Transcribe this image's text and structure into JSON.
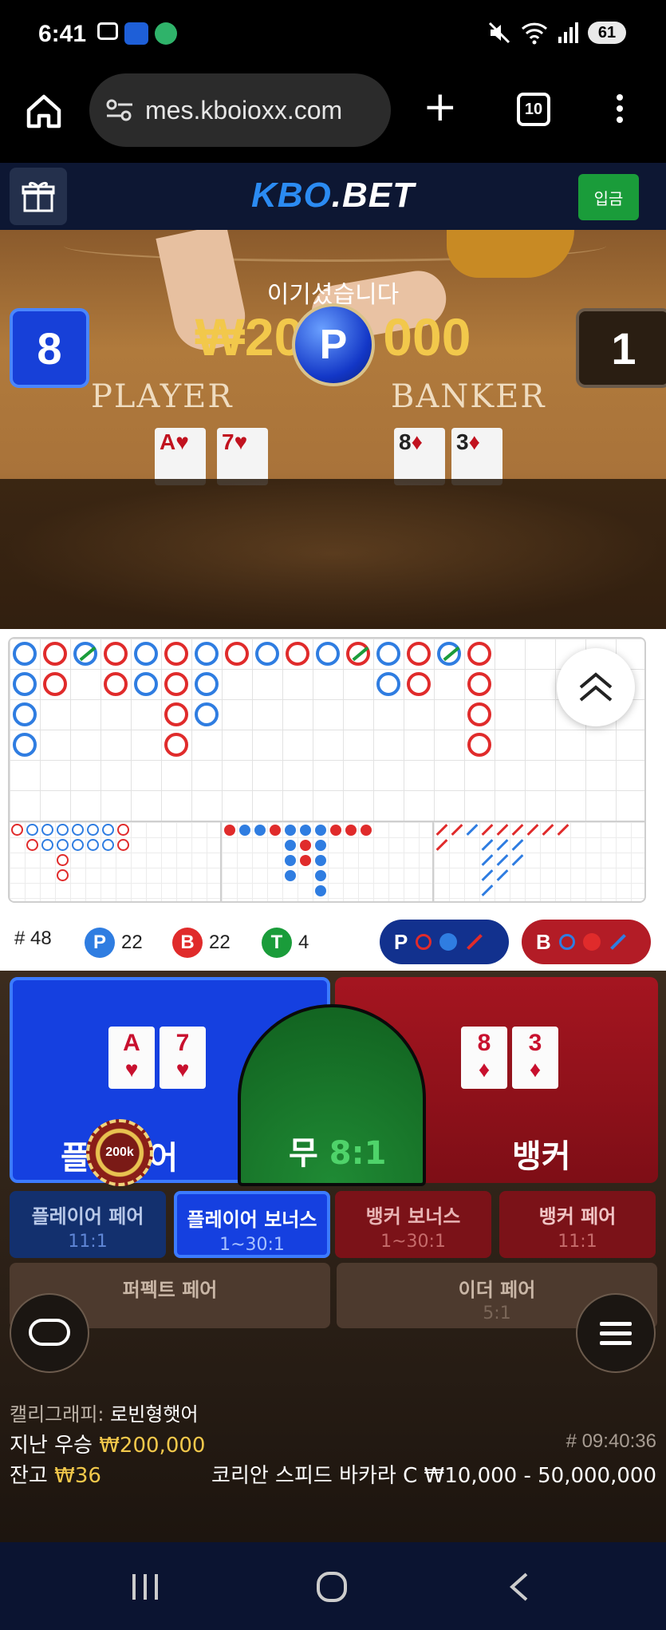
{
  "status_bar": {
    "time": "6:41",
    "battery": "61",
    "left_icons": [
      "screenshot-icon",
      "app-badge-icon",
      "talk-icon"
    ],
    "right_icons": [
      "mute-icon",
      "wifi-icon",
      "signal-icon"
    ]
  },
  "browser": {
    "url": "mes.kboioxx.com",
    "tab_count": "10"
  },
  "site": {
    "logo_kbo": "KBO",
    "logo_bet": ".BET",
    "deposit_label": "입금"
  },
  "video": {
    "player_label": "PLAYER",
    "banker_label": "BANKER",
    "player_cards": [
      {
        "rank": "A",
        "suit": "♥"
      },
      {
        "rank": "7",
        "suit": "♥"
      }
    ],
    "banker_cards": [
      {
        "rank": "8",
        "suit": "♦"
      },
      {
        "rank": "3",
        "suit": "♦"
      }
    ],
    "win_text": "이기셨습니다",
    "win_amount": "₩20",
    "win_amount_tail": "000",
    "result_badge": "P",
    "player_score": "8",
    "banker_score": "1"
  },
  "stats": {
    "count_label": "# 48",
    "player_badge": "P",
    "player_count": "22",
    "banker_badge": "B",
    "banker_count": "22",
    "tie_badge": "T",
    "tie_count": "4",
    "player_predict_label": "P",
    "banker_predict_label": "B"
  },
  "betting": {
    "player_label": "플레이어",
    "tie_label": "무",
    "tie_odds": "8:1",
    "banker_label": "뱅커",
    "chip_value": "200k",
    "side_bets": [
      {
        "label": "플레이어 페어",
        "odds": "11:1"
      },
      {
        "label": "플레이어 보너스",
        "odds": "1~30:1"
      },
      {
        "label": "뱅커 보너스",
        "odds": "1~30:1"
      },
      {
        "label": "뱅커 페어",
        "odds": "11:1"
      }
    ],
    "pair_bets": [
      {
        "label": "퍼펙트 페어",
        "odds": ""
      },
      {
        "label": "이더 페어",
        "odds": "5:1"
      }
    ]
  },
  "info": {
    "dealer_label": "캘리그래피:",
    "dealer_name": "로빈형햇어",
    "last_win_label": "지난 우승",
    "last_win_amount": "₩200,000",
    "round_id": "# 09:40:36",
    "balance_label": "잔고",
    "balance_amount": "₩36",
    "table_name": "코리안 스피드 바카라 C",
    "table_limits": "₩10,000 - 50,000,000"
  },
  "colors": {
    "player_blue": "#1540e0",
    "banker_red": "#a51520",
    "tie_green": "#1f8a34",
    "gold": "#f2c84b",
    "header_navy": "#0d1733"
  }
}
